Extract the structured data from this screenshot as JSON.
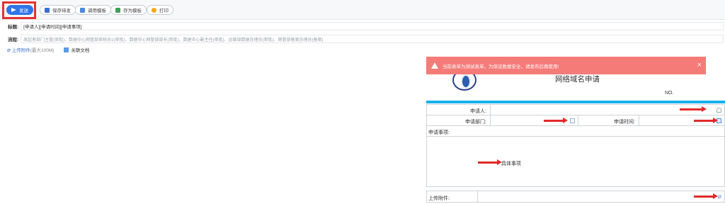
{
  "toolbar": {
    "send_label": "发送",
    "save_label": "保存待发",
    "call_template_label": "调用模板",
    "save_template_label": "存为模板",
    "print_label": "打印"
  },
  "subject": {
    "label": "标题:",
    "value": "[申请人][申请时间][申请事项]"
  },
  "flow": {
    "label": "流程:",
    "value": "发起者部门主管(审批)、数据中心网管部审核员1(审批)、数据中心网管部部长(审批)、数据中心副主任(审批)、运维部数据办理员(审批)、网管部备案办理员(备案)"
  },
  "attachments": {
    "upload_label": "上传附件",
    "max_size": "(最大100M)",
    "related_doc_label": "关联文档"
  },
  "alert": {
    "message": "当前表单为测试表单，为保证数据安全，请发布后再使用!",
    "close": "×"
  },
  "form": {
    "title": "网络域名申请",
    "no_label": "NO.",
    "applicant_label": "申请人:",
    "department_label": "申请部门:",
    "date_label": "申请时间:",
    "matter_label": "申请事项:",
    "matter_annotation": "具体事项",
    "attach_label": "上传附件:"
  },
  "colors": {
    "primary": "#2f74e8",
    "highlight": "#e23232",
    "alert_bg": "#f57b79",
    "header_bar": "#17b2ec",
    "annotation_arrow": "#e22a2a"
  }
}
